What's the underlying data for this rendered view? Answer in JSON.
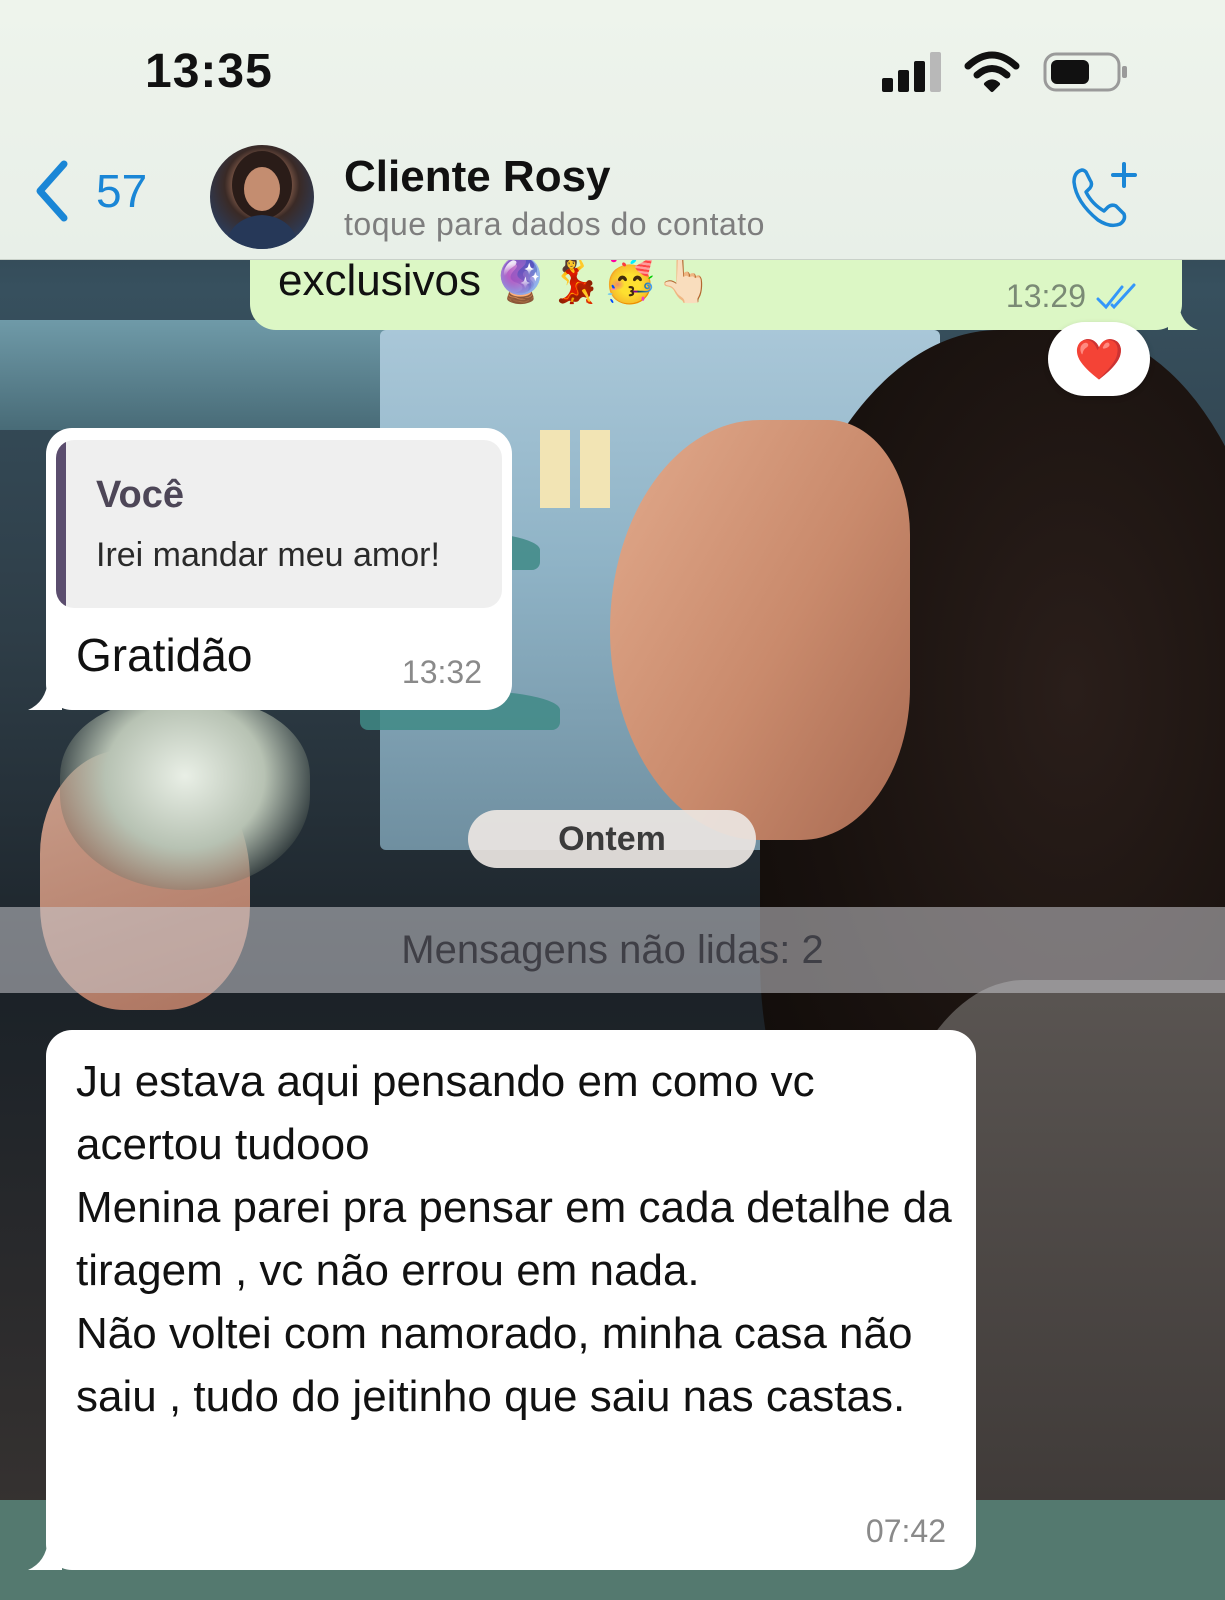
{
  "status_bar": {
    "time": "13:35"
  },
  "header": {
    "back_count": "57",
    "contact_name": "Cliente Rosy",
    "contact_subtitle": "toque para dados do contato",
    "accent_color": "#1a86d6"
  },
  "messages": {
    "outgoing_last": {
      "text": "exclusivos 🔮💃🥳👆🏻",
      "time": "13:29",
      "read_status": "double-check-read-icon",
      "reaction": "❤️"
    },
    "reply": {
      "quote_author": "Você",
      "quote_text": "Irei mandar meu amor!",
      "text": "Gratidão",
      "time": "13:32"
    },
    "date_separator": "Ontem",
    "unread_banner": "Mensagens não lidas: 2",
    "incoming_long": {
      "text": "Ju estava aqui pensando em como vc acertou tudooo\nMenina parei pra pensar em cada detalhe da tiragem , vc  não errou em nada.\nNão voltei com namorado, minha casa não saiu , tudo do jeitinho que saiu nas castas.",
      "time": "07:42"
    }
  },
  "colors": {
    "outgoing_bubble": "#dcf7c5",
    "incoming_bubble": "#ffffff",
    "read_ticks": "#3497f9"
  }
}
